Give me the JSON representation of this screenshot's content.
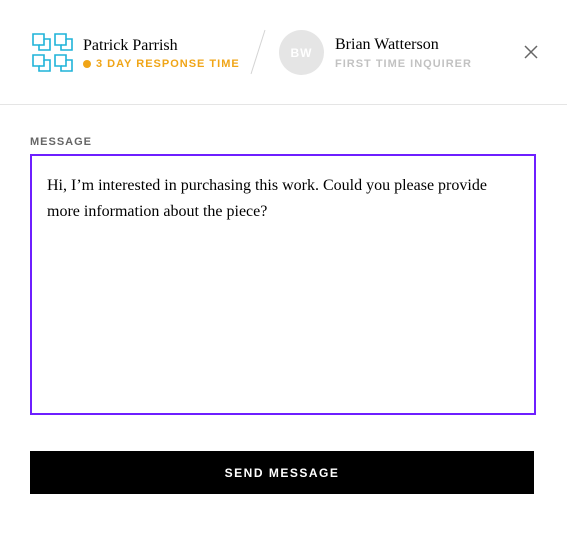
{
  "gallery": {
    "name": "Patrick Parrish",
    "response_time": "3 DAY RESPONSE TIME",
    "icon": "gallery-logo-icon"
  },
  "user": {
    "initials": "BW",
    "name": "Brian Watterson",
    "status": "FIRST TIME INQUIRER"
  },
  "close": {
    "icon": "close-icon"
  },
  "form": {
    "label": "MESSAGE",
    "message": "Hi, I’m interested in purchasing this work. Could you please provide more information about the piece?",
    "submit_label": "SEND MESSAGE"
  },
  "colors": {
    "accent": "#6e1fff",
    "response_time": "#f0a517",
    "button_bg": "#000000",
    "avatar_bg": "#e5e5e5",
    "logo": "#1fb3d9"
  }
}
